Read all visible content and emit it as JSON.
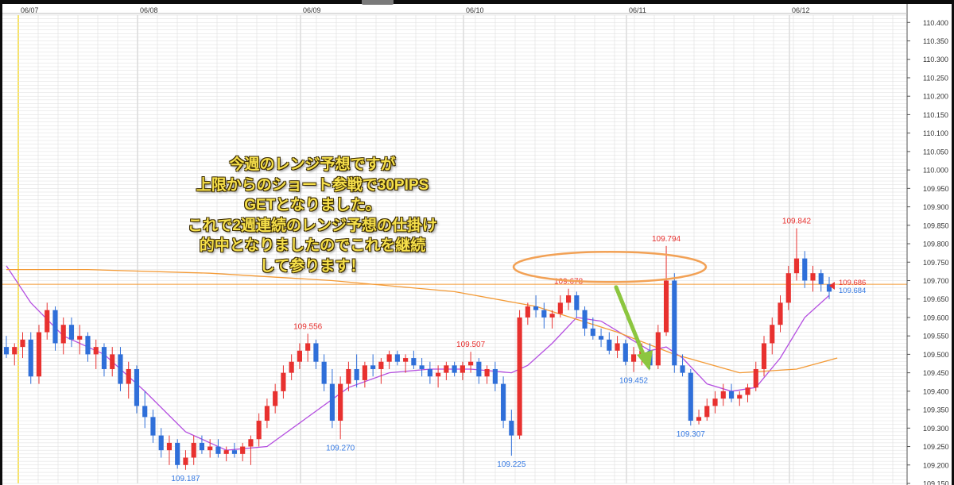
{
  "annotation": {
    "lines": [
      "今週のレンジ予想ですが",
      "上限からのショート参戦で30PIPS",
      "GETとなりました。",
      "これで2週連続のレンジ予想の仕掛け",
      "的中となりましたのでこれを継続",
      "して参ります！"
    ]
  },
  "chart_data": {
    "type": "candlestick",
    "title": "",
    "xlabel": "",
    "ylabel": "",
    "date_labels": [
      "06/07",
      "06/08",
      "06/09",
      "06/10",
      "06/11",
      "06/12"
    ],
    "y_ticks": [
      110.4,
      110.35,
      110.3,
      110.25,
      110.2,
      110.15,
      110.1,
      110.05,
      110.0,
      109.95,
      109.9,
      109.85,
      109.8,
      109.75,
      109.7,
      109.65,
      109.6,
      109.55,
      109.5,
      109.45,
      109.4,
      109.35,
      109.3,
      109.25,
      109.2,
      109.15
    ],
    "ylim": [
      109.15,
      110.42
    ],
    "current_price_bid": 109.686,
    "current_price_ask": 109.684,
    "horizontal_line": 109.69,
    "high_labels": [
      {
        "date": "06/08 10:00",
        "value": 109.556
      },
      {
        "date": "06/09 14:00",
        "value": 109.507
      },
      {
        "date": "06/10 03:00",
        "value": 109.678
      },
      {
        "date": "06/10 21:00",
        "value": 109.794
      },
      {
        "date": "06/11 23:00",
        "value": 109.842
      }
    ],
    "low_labels": [
      {
        "date": "06/07 15:00",
        "value": 109.187
      },
      {
        "date": "06/08 17:00",
        "value": 109.27
      },
      {
        "date": "06/09 22:00",
        "value": 109.225
      },
      {
        "date": "06/10 11:00",
        "value": 109.452
      },
      {
        "date": "06/11 01:00",
        "value": 109.307
      }
    ],
    "series": [
      {
        "kind": "ohlc",
        "up_color": "#e8312f",
        "down_color": "#2f6fd9",
        "values": [
          [
            109.52,
            109.55,
            109.49,
            109.5
          ],
          [
            109.5,
            109.53,
            109.47,
            109.52
          ],
          [
            109.52,
            109.56,
            109.49,
            109.54
          ],
          [
            109.54,
            109.56,
            109.42,
            109.44
          ],
          [
            109.44,
            109.58,
            109.42,
            109.56
          ],
          [
            109.56,
            109.64,
            109.54,
            109.62
          ],
          [
            109.62,
            109.63,
            109.51,
            109.53
          ],
          [
            109.53,
            109.6,
            109.5,
            109.58
          ],
          [
            109.58,
            109.6,
            109.52,
            109.54
          ],
          [
            109.54,
            109.58,
            109.5,
            109.55
          ],
          [
            109.55,
            109.56,
            109.48,
            109.5
          ],
          [
            109.5,
            109.54,
            109.46,
            109.52
          ],
          [
            109.52,
            109.53,
            109.44,
            109.46
          ],
          [
            109.46,
            109.52,
            109.44,
            109.5
          ],
          [
            109.5,
            109.52,
            109.4,
            109.42
          ],
          [
            109.42,
            109.48,
            109.38,
            109.46
          ],
          [
            109.46,
            109.47,
            109.34,
            109.36
          ],
          [
            109.36,
            109.4,
            109.3,
            109.33
          ],
          [
            109.33,
            109.35,
            109.26,
            109.28
          ],
          [
            109.28,
            109.3,
            109.22,
            109.24
          ],
          [
            109.24,
            109.28,
            109.2,
            109.26
          ],
          [
            109.26,
            109.27,
            109.19,
            109.2
          ],
          [
            109.2,
            109.24,
            109.187,
            109.22
          ],
          [
            109.22,
            109.28,
            109.2,
            109.26
          ],
          [
            109.26,
            109.28,
            109.23,
            109.24
          ],
          [
            109.24,
            109.27,
            109.22,
            109.25
          ],
          [
            109.25,
            109.27,
            109.22,
            109.23
          ],
          [
            109.23,
            109.25,
            109.21,
            109.24
          ],
          [
            109.24,
            109.26,
            109.22,
            109.23
          ],
          [
            109.23,
            109.26,
            109.21,
            109.25
          ],
          [
            109.25,
            109.28,
            109.2,
            109.27
          ],
          [
            109.27,
            109.34,
            109.25,
            109.32
          ],
          [
            109.32,
            109.38,
            109.3,
            109.36
          ],
          [
            109.36,
            109.42,
            109.34,
            109.4
          ],
          [
            109.4,
            109.47,
            109.38,
            109.45
          ],
          [
            109.45,
            109.5,
            109.43,
            109.48
          ],
          [
            109.48,
            109.53,
            109.46,
            109.51
          ],
          [
            109.51,
            109.556,
            109.48,
            109.53
          ],
          [
            109.53,
            109.54,
            109.46,
            109.48
          ],
          [
            109.48,
            109.5,
            109.4,
            109.42
          ],
          [
            109.42,
            109.46,
            109.3,
            109.32
          ],
          [
            109.32,
            109.44,
            109.27,
            109.42
          ],
          [
            109.42,
            109.48,
            109.4,
            109.46
          ],
          [
            109.46,
            109.5,
            109.41,
            109.43
          ],
          [
            109.43,
            109.48,
            109.41,
            109.47
          ],
          [
            109.47,
            109.5,
            109.44,
            109.46
          ],
          [
            109.46,
            109.49,
            109.42,
            109.48
          ],
          [
            109.48,
            109.51,
            109.46,
            109.5
          ],
          [
            109.5,
            109.51,
            109.47,
            109.48
          ],
          [
            109.48,
            109.5,
            109.45,
            109.49
          ],
          [
            109.49,
            109.51,
            109.46,
            109.47
          ],
          [
            109.47,
            109.49,
            109.44,
            109.46
          ],
          [
            109.46,
            109.48,
            109.42,
            109.44
          ],
          [
            109.44,
            109.47,
            109.41,
            109.45
          ],
          [
            109.45,
            109.48,
            109.43,
            109.47
          ],
          [
            109.47,
            109.48,
            109.44,
            109.45
          ],
          [
            109.45,
            109.48,
            109.43,
            109.47
          ],
          [
            109.47,
            109.507,
            109.45,
            109.48
          ],
          [
            109.48,
            109.49,
            109.42,
            109.44
          ],
          [
            109.44,
            109.47,
            109.42,
            109.46
          ],
          [
            109.46,
            109.48,
            109.4,
            109.42
          ],
          [
            109.42,
            109.44,
            109.3,
            109.32
          ],
          [
            109.32,
            109.35,
            109.225,
            109.28
          ],
          [
            109.28,
            109.62,
            109.27,
            109.6
          ],
          [
            109.6,
            109.64,
            109.58,
            109.63
          ],
          [
            109.63,
            109.66,
            109.6,
            109.62
          ],
          [
            109.62,
            109.64,
            109.57,
            109.6
          ],
          [
            109.6,
            109.62,
            109.57,
            109.61
          ],
          [
            109.61,
            109.66,
            109.6,
            109.64
          ],
          [
            109.64,
            109.678,
            109.62,
            109.66
          ],
          [
            109.66,
            109.67,
            109.6,
            109.62
          ],
          [
            109.62,
            109.63,
            109.55,
            109.57
          ],
          [
            109.57,
            109.6,
            109.54,
            109.55
          ],
          [
            109.55,
            109.57,
            109.52,
            109.54
          ],
          [
            109.54,
            109.56,
            109.5,
            109.51
          ],
          [
            109.51,
            109.55,
            109.49,
            109.53
          ],
          [
            109.53,
            109.54,
            109.47,
            109.48
          ],
          [
            109.48,
            109.52,
            109.452,
            109.5
          ],
          [
            109.5,
            109.53,
            109.47,
            109.51
          ],
          [
            109.51,
            109.53,
            109.46,
            109.47
          ],
          [
            109.47,
            109.58,
            109.46,
            109.56
          ],
          [
            109.56,
            109.794,
            109.55,
            109.7
          ],
          [
            109.7,
            109.72,
            109.45,
            109.47
          ],
          [
            109.47,
            109.5,
            109.44,
            109.45
          ],
          [
            109.45,
            109.46,
            109.307,
            109.32
          ],
          [
            109.32,
            109.35,
            109.31,
            109.33
          ],
          [
            109.33,
            109.38,
            109.32,
            109.36
          ],
          [
            109.36,
            109.4,
            109.34,
            109.38
          ],
          [
            109.38,
            109.42,
            109.36,
            109.4
          ],
          [
            109.4,
            109.42,
            109.37,
            109.38
          ],
          [
            109.38,
            109.4,
            109.36,
            109.39
          ],
          [
            109.39,
            109.42,
            109.37,
            109.41
          ],
          [
            109.41,
            109.48,
            109.4,
            109.46
          ],
          [
            109.46,
            109.55,
            109.44,
            109.53
          ],
          [
            109.53,
            109.6,
            109.5,
            109.58
          ],
          [
            109.58,
            109.66,
            109.56,
            109.64
          ],
          [
            109.64,
            109.74,
            109.62,
            109.72
          ],
          [
            109.72,
            109.842,
            109.7,
            109.76
          ],
          [
            109.76,
            109.78,
            109.68,
            109.7
          ],
          [
            109.7,
            109.74,
            109.67,
            109.72
          ],
          [
            109.72,
            109.73,
            109.67,
            109.69
          ],
          [
            109.69,
            109.71,
            109.65,
            109.67
          ]
        ]
      },
      {
        "name": "",
        "kind": "ma_short",
        "color": "#b44ee0",
        "values": [
          [
            0,
            109.74
          ],
          [
            3,
            109.64
          ],
          [
            7,
            109.55
          ],
          [
            12,
            109.5
          ],
          [
            17,
            109.4
          ],
          [
            22,
            109.29
          ],
          [
            27,
            109.24
          ],
          [
            32,
            109.25
          ],
          [
            37,
            109.33
          ],
          [
            42,
            109.41
          ],
          [
            47,
            109.45
          ],
          [
            52,
            109.46
          ],
          [
            57,
            109.46
          ],
          [
            62,
            109.45
          ],
          [
            64,
            109.47
          ],
          [
            67,
            109.53
          ],
          [
            70,
            109.6
          ],
          [
            73,
            109.59
          ],
          [
            76,
            109.55
          ],
          [
            79,
            109.51
          ],
          [
            81,
            109.52
          ],
          [
            83,
            109.49
          ],
          [
            86,
            109.42
          ],
          [
            89,
            109.4
          ],
          [
            92,
            109.41
          ],
          [
            95,
            109.49
          ],
          [
            98,
            109.6
          ],
          [
            101,
            109.66
          ]
        ]
      },
      {
        "name": "",
        "kind": "ma_long",
        "color": "#f39a36",
        "values": [
          [
            0,
            109.73
          ],
          [
            10,
            109.73
          ],
          [
            25,
            109.72
          ],
          [
            40,
            109.7
          ],
          [
            55,
            109.67
          ],
          [
            65,
            109.63
          ],
          [
            75,
            109.56
          ],
          [
            82,
            109.5
          ],
          [
            90,
            109.45
          ],
          [
            97,
            109.46
          ],
          [
            102,
            109.49
          ]
        ]
      }
    ]
  },
  "highlight": {
    "ellipse_color": "#f2a155",
    "arrow_color": "#8cc63f"
  },
  "colors": {
    "grid": "#dedede",
    "axis": "#555555",
    "price_up_label": "#e8312f",
    "price_down_label": "#3579e2",
    "current_price_marker": "#e8312f",
    "vertical_session_line": "#f2d000"
  }
}
